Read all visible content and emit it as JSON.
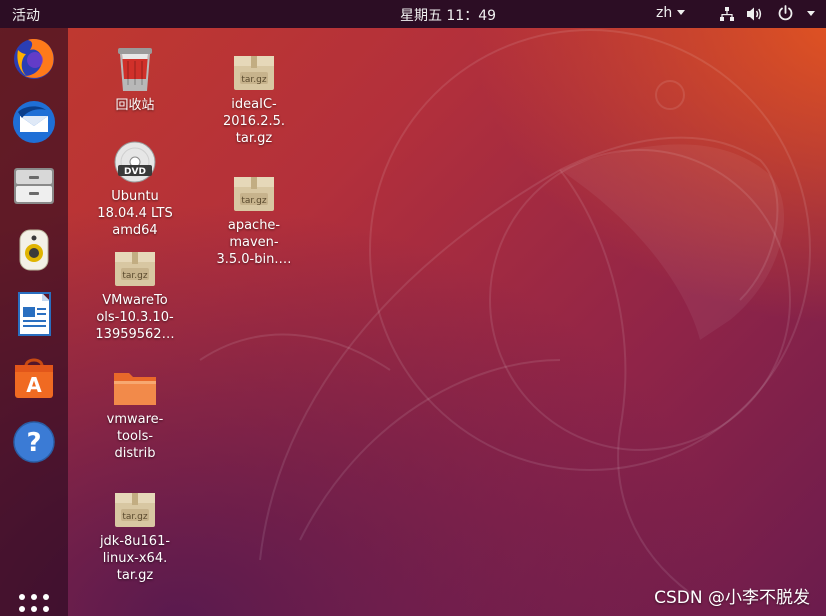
{
  "top_bar": {
    "activities_label": "活动",
    "clock": "星期五 11：49",
    "input_method": "zh"
  },
  "dock": {
    "items": [
      {
        "name": "firefox"
      },
      {
        "name": "thunderbird"
      },
      {
        "name": "files"
      },
      {
        "name": "rhythmbox"
      },
      {
        "name": "libreoffice-writer"
      },
      {
        "name": "ubuntu-software"
      },
      {
        "name": "help"
      },
      {
        "name": "show-applications"
      }
    ]
  },
  "desktop": {
    "icons": [
      {
        "label": "回收站",
        "icon": "trash-icon"
      },
      {
        "label": "Ubuntu\n18.04.4 LTS\namd64",
        "icon": "dvd-icon"
      },
      {
        "label": "VMwareTo\nols-10.3.10-\n13959562…",
        "icon": "archive-icon"
      },
      {
        "label": "vmware-\ntools-\ndistrib",
        "icon": "folder-icon"
      },
      {
        "label": "jdk-8u161-\nlinux-x64.\ntar.gz",
        "icon": "archive-icon"
      },
      {
        "label": "ideaIC-\n2016.2.5.\ntar.gz",
        "icon": "archive-icon"
      },
      {
        "label": "apache-\nmaven-\n3.5.0-bin.…",
        "icon": "archive-icon"
      }
    ],
    "archive_badge": "tar.gz",
    "dvd_badge": "DVD"
  },
  "watermark": "CSDN @小李不脱发",
  "colors": {
    "top_bar": "#2c0d24",
    "wallpaper_orange": "#e5561f",
    "wallpaper_purple": "#6b1c4d"
  }
}
